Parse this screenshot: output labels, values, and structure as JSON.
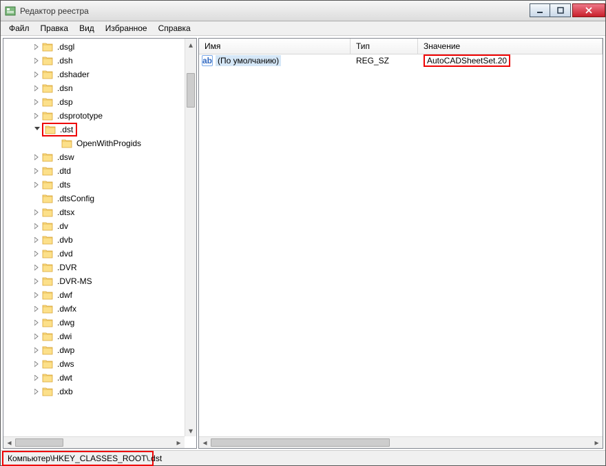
{
  "window": {
    "title": "Редактор реестра"
  },
  "menu": {
    "items": [
      "Файл",
      "Правка",
      "Вид",
      "Избранное",
      "Справка"
    ]
  },
  "tree": {
    "items": [
      {
        "label": ".dsgl",
        "depth": 0,
        "exp": "collapsed"
      },
      {
        "label": ".dsh",
        "depth": 0,
        "exp": "collapsed"
      },
      {
        "label": ".dshader",
        "depth": 0,
        "exp": "collapsed"
      },
      {
        "label": ".dsn",
        "depth": 0,
        "exp": "collapsed"
      },
      {
        "label": ".dsp",
        "depth": 0,
        "exp": "collapsed"
      },
      {
        "label": ".dsprototype",
        "depth": 0,
        "exp": "collapsed"
      },
      {
        "label": ".dst",
        "depth": 0,
        "exp": "expanded",
        "highlight": true
      },
      {
        "label": "OpenWithProgids",
        "depth": 1,
        "exp": "none"
      },
      {
        "label": ".dsw",
        "depth": 0,
        "exp": "collapsed"
      },
      {
        "label": ".dtd",
        "depth": 0,
        "exp": "collapsed"
      },
      {
        "label": ".dts",
        "depth": 0,
        "exp": "collapsed"
      },
      {
        "label": ".dtsConfig",
        "depth": 0,
        "exp": "none"
      },
      {
        "label": ".dtsx",
        "depth": 0,
        "exp": "collapsed"
      },
      {
        "label": ".dv",
        "depth": 0,
        "exp": "collapsed"
      },
      {
        "label": ".dvb",
        "depth": 0,
        "exp": "collapsed"
      },
      {
        "label": ".dvd",
        "depth": 0,
        "exp": "collapsed"
      },
      {
        "label": ".DVR",
        "depth": 0,
        "exp": "collapsed"
      },
      {
        "label": ".DVR-MS",
        "depth": 0,
        "exp": "collapsed"
      },
      {
        "label": ".dwf",
        "depth": 0,
        "exp": "collapsed"
      },
      {
        "label": ".dwfx",
        "depth": 0,
        "exp": "collapsed"
      },
      {
        "label": ".dwg",
        "depth": 0,
        "exp": "collapsed"
      },
      {
        "label": ".dwi",
        "depth": 0,
        "exp": "collapsed"
      },
      {
        "label": ".dwp",
        "depth": 0,
        "exp": "collapsed"
      },
      {
        "label": ".dws",
        "depth": 0,
        "exp": "collapsed"
      },
      {
        "label": ".dwt",
        "depth": 0,
        "exp": "collapsed"
      },
      {
        "label": ".dxb",
        "depth": 0,
        "exp": "collapsed"
      }
    ]
  },
  "list": {
    "headers": {
      "name": "Имя",
      "type": "Тип",
      "value": "Значение"
    },
    "rows": [
      {
        "name": "(По умолчанию)",
        "type": "REG_SZ",
        "value": "AutoCADSheetSet.20",
        "icon": "ab"
      }
    ]
  },
  "status": {
    "path": "Компьютер\\HKEY_CLASSES_ROOT\\.dst"
  }
}
